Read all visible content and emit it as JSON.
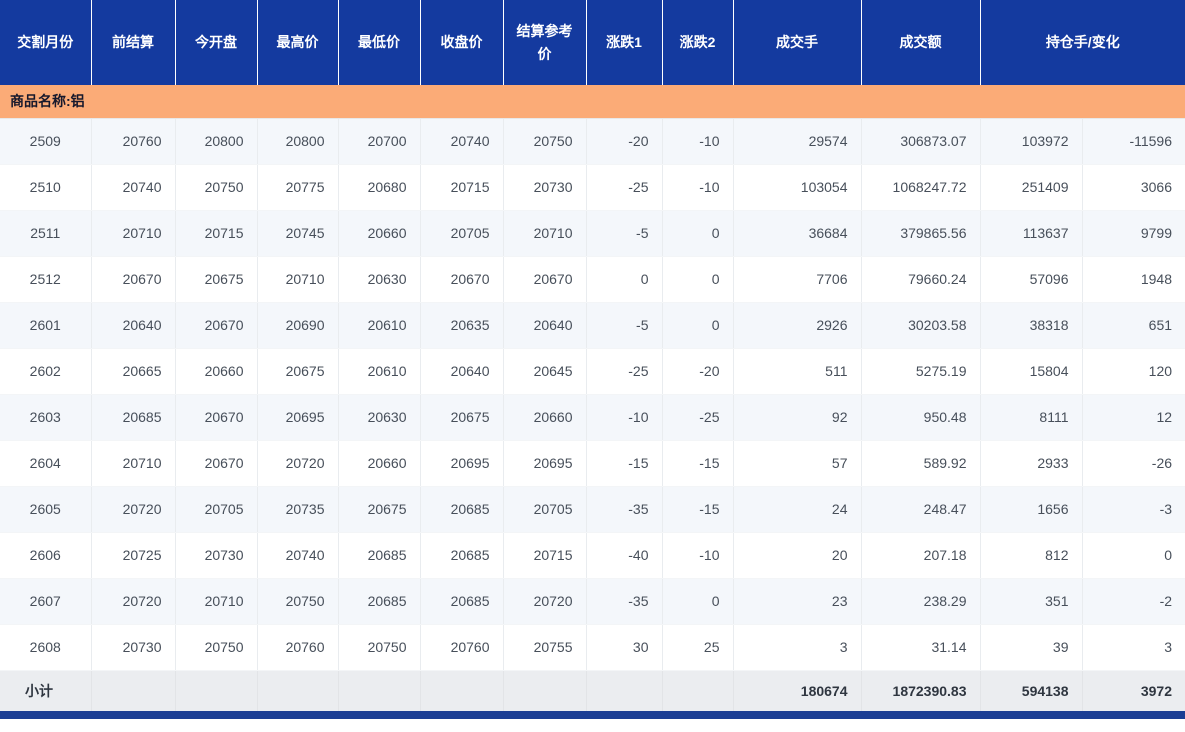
{
  "table": {
    "columns": [
      {
        "key": "delivery_month",
        "label": "交割月份"
      },
      {
        "key": "prev_settlement",
        "label": "前结算"
      },
      {
        "key": "open",
        "label": "今开盘"
      },
      {
        "key": "high",
        "label": "最高价"
      },
      {
        "key": "low",
        "label": "最低价"
      },
      {
        "key": "close",
        "label": "收盘价"
      },
      {
        "key": "settlement_ref",
        "label": "结算参考价"
      },
      {
        "key": "change1",
        "label": "涨跌1"
      },
      {
        "key": "change2",
        "label": "涨跌2"
      },
      {
        "key": "volume",
        "label": "成交手"
      },
      {
        "key": "turnover",
        "label": "成交额"
      },
      {
        "key": "oi_and_change",
        "label": "持仓手/变化"
      }
    ],
    "column_keys": [
      "delivery_month",
      "prev_settlement",
      "open",
      "high",
      "low",
      "close",
      "settlement_ref",
      "change1",
      "change2",
      "volume",
      "turnover",
      "open_interest",
      "oi_change"
    ],
    "group_label": "商品名称:铝",
    "rows": [
      [
        "2509",
        "20760",
        "20800",
        "20800",
        "20700",
        "20740",
        "20750",
        "-20",
        "-10",
        "29574",
        "306873.07",
        "103972",
        "-11596"
      ],
      [
        "2510",
        "20740",
        "20750",
        "20775",
        "20680",
        "20715",
        "20730",
        "-25",
        "-10",
        "103054",
        "1068247.72",
        "251409",
        "3066"
      ],
      [
        "2511",
        "20710",
        "20715",
        "20745",
        "20660",
        "20705",
        "20710",
        "-5",
        "0",
        "36684",
        "379865.56",
        "113637",
        "9799"
      ],
      [
        "2512",
        "20670",
        "20675",
        "20710",
        "20630",
        "20670",
        "20670",
        "0",
        "0",
        "7706",
        "79660.24",
        "57096",
        "1948"
      ],
      [
        "2601",
        "20640",
        "20670",
        "20690",
        "20610",
        "20635",
        "20640",
        "-5",
        "0",
        "2926",
        "30203.58",
        "38318",
        "651"
      ],
      [
        "2602",
        "20665",
        "20660",
        "20675",
        "20610",
        "20640",
        "20645",
        "-25",
        "-20",
        "511",
        "5275.19",
        "15804",
        "120"
      ],
      [
        "2603",
        "20685",
        "20670",
        "20695",
        "20630",
        "20675",
        "20660",
        "-10",
        "-25",
        "92",
        "950.48",
        "8111",
        "12"
      ],
      [
        "2604",
        "20710",
        "20670",
        "20720",
        "20660",
        "20695",
        "20695",
        "-15",
        "-15",
        "57",
        "589.92",
        "2933",
        "-26"
      ],
      [
        "2605",
        "20720",
        "20705",
        "20735",
        "20675",
        "20685",
        "20705",
        "-35",
        "-15",
        "24",
        "248.47",
        "1656",
        "-3"
      ],
      [
        "2606",
        "20725",
        "20730",
        "20740",
        "20685",
        "20685",
        "20715",
        "-40",
        "-10",
        "20",
        "207.18",
        "812",
        "0"
      ],
      [
        "2607",
        "20720",
        "20710",
        "20750",
        "20685",
        "20685",
        "20720",
        "-35",
        "0",
        "23",
        "238.29",
        "351",
        "-2"
      ],
      [
        "2608",
        "20730",
        "20750",
        "20760",
        "20750",
        "20760",
        "20755",
        "30",
        "25",
        "3",
        "31.14",
        "39",
        "3"
      ]
    ],
    "subtotal": {
      "label": "小计",
      "volume": "180674",
      "turnover": "1872390.83",
      "open_interest": "594138",
      "oi_change": "3972"
    }
  },
  "colors": {
    "header_bg": "#143a9f",
    "header_text": "#ffffff",
    "group_band_bg": "#fbab77",
    "group_band_text": "#16182c",
    "row_alt_bg": "#f4f7fb",
    "row_bg": "#ffffff",
    "cell_text": "#474f5a",
    "subtotal_bg": "#ebedf0",
    "bottom_bar_bg": "#1b3e94"
  }
}
